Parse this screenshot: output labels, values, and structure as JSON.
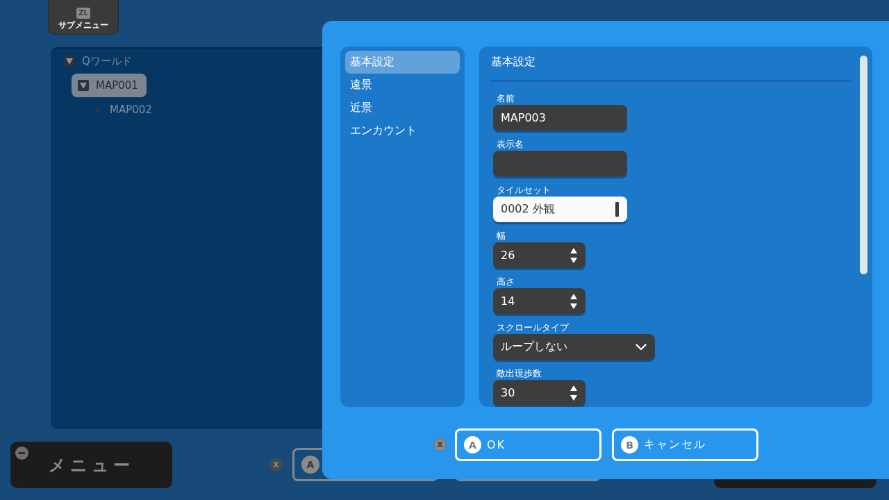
{
  "submenu_button": {
    "key": "ZL",
    "label": "サブメニュー"
  },
  "map_tree": [
    {
      "label": "Qワールド",
      "expanded": true,
      "selected": false,
      "children": [
        {
          "label": "MAP001",
          "expanded": true,
          "selected": true,
          "children": [
            {
              "label": "MAP002",
              "selected": false
            }
          ]
        }
      ]
    }
  ],
  "menu_button": {
    "label": "メニュー"
  },
  "bottom_bar": {
    "shortcut_key": "X",
    "buttons": [
      {
        "kind": "outlined",
        "key": "A"
      },
      {
        "kind": "outlined"
      },
      {
        "kind": "dark"
      }
    ]
  },
  "dialog": {
    "nav": [
      {
        "label": "基本設定",
        "selected": true
      },
      {
        "label": "遠景",
        "selected": false
      },
      {
        "label": "近景",
        "selected": false
      },
      {
        "label": "エンカウント",
        "selected": false
      }
    ],
    "section_title": "基本設定",
    "fields": [
      {
        "kind": "text",
        "label": "名前",
        "value": "MAP003",
        "focused": false
      },
      {
        "kind": "text",
        "label": "表示名",
        "focused": false
      },
      {
        "kind": "text",
        "label": "タイルセット",
        "value": "0002 外観",
        "focused": true
      },
      {
        "kind": "number",
        "label": "幅",
        "value": "26",
        "focused": false
      },
      {
        "kind": "number",
        "label": "高さ",
        "value": "14",
        "focused": false
      },
      {
        "kind": "dropdown",
        "label": "スクロールタイプ",
        "value": "ループしない",
        "focused": false
      },
      {
        "kind": "number",
        "label": "敵出現歩数",
        "value": "30",
        "focused": false
      }
    ],
    "shortcut_key": "X",
    "buttons": [
      {
        "key": "A",
        "label": "OK"
      },
      {
        "key": "B",
        "label": "キャンセル"
      }
    ]
  }
}
